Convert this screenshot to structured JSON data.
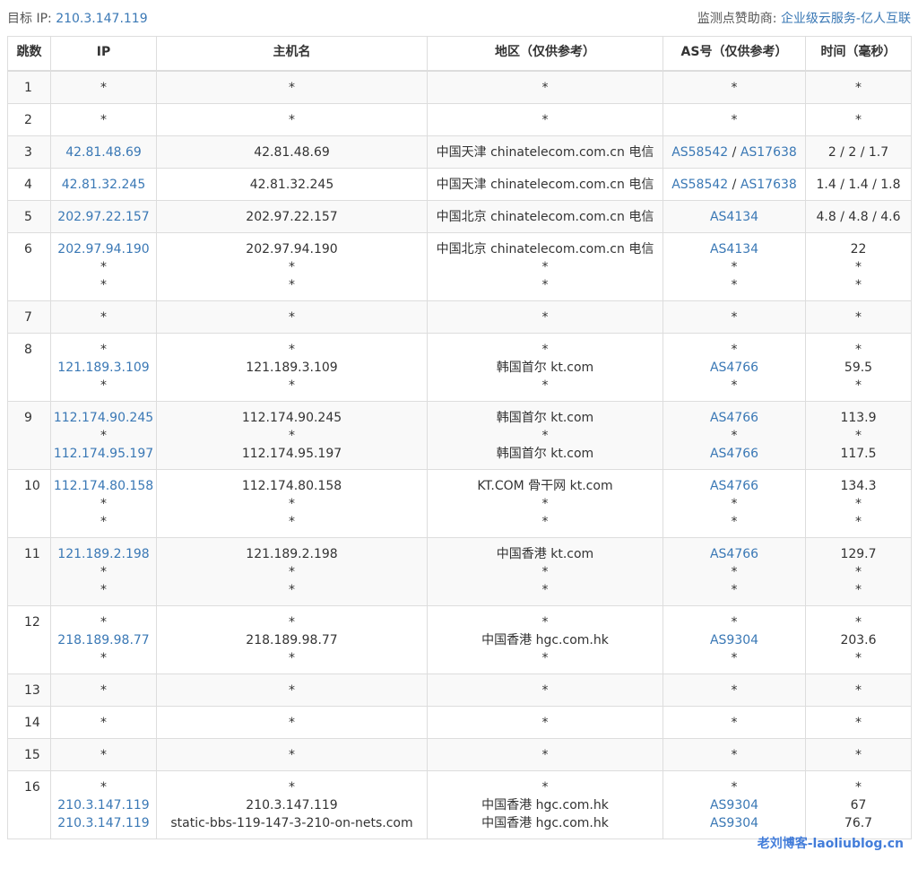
{
  "header": {
    "target_label": "目标 IP:",
    "target_ip": "210.3.147.119",
    "sponsor_label": "监测点赞助商:",
    "sponsor_name": "企业级云服务-亿人互联"
  },
  "table": {
    "columns": [
      "跳数",
      "IP",
      "主机名",
      "地区（仅供参考）",
      "AS号（仅供参考）",
      "时间（毫秒）"
    ],
    "rows": [
      {
        "hop": "1",
        "lines": [
          {
            "ip": "*",
            "host": "*",
            "region": "*",
            "as": [
              "*"
            ],
            "time": "*"
          }
        ]
      },
      {
        "hop": "2",
        "lines": [
          {
            "ip": "*",
            "host": "*",
            "region": "*",
            "as": [
              "*"
            ],
            "time": "*"
          }
        ]
      },
      {
        "hop": "3",
        "lines": [
          {
            "ip": "42.81.48.69",
            "host": "42.81.48.69",
            "region": "中国天津 chinatelecom.com.cn 电信",
            "as": [
              "AS58542",
              "AS17638"
            ],
            "time": "2 / 2 / 1.7"
          }
        ]
      },
      {
        "hop": "4",
        "lines": [
          {
            "ip": "42.81.32.245",
            "host": "42.81.32.245",
            "region": "中国天津 chinatelecom.com.cn 电信",
            "as": [
              "AS58542",
              "AS17638"
            ],
            "time": "1.4 / 1.4 / 1.8"
          }
        ]
      },
      {
        "hop": "5",
        "lines": [
          {
            "ip": "202.97.22.157",
            "host": "202.97.22.157",
            "region": "中国北京 chinatelecom.com.cn 电信",
            "as": [
              "AS4134"
            ],
            "time": "4.8 / 4.8 / 4.6"
          }
        ]
      },
      {
        "hop": "6",
        "lines": [
          {
            "ip": "202.97.94.190",
            "host": "202.97.94.190",
            "region": "中国北京 chinatelecom.com.cn 电信",
            "as": [
              "AS4134"
            ],
            "time": "22"
          },
          {
            "ip": "*",
            "host": "*",
            "region": "*",
            "as": [
              "*"
            ],
            "time": "*"
          },
          {
            "ip": "*",
            "host": "*",
            "region": "*",
            "as": [
              "*"
            ],
            "time": "*"
          }
        ]
      },
      {
        "hop": "7",
        "lines": [
          {
            "ip": "*",
            "host": "*",
            "region": "*",
            "as": [
              "*"
            ],
            "time": "*"
          }
        ]
      },
      {
        "hop": "8",
        "lines": [
          {
            "ip": "*",
            "host": "*",
            "region": "*",
            "as": [
              "*"
            ],
            "time": "*"
          },
          {
            "ip": "121.189.3.109",
            "host": "121.189.3.109",
            "region": "韩国首尔 kt.com",
            "as": [
              "AS4766"
            ],
            "time": "59.5"
          },
          {
            "ip": "*",
            "host": "*",
            "region": "*",
            "as": [
              "*"
            ],
            "time": "*"
          }
        ]
      },
      {
        "hop": "9",
        "lines": [
          {
            "ip": "112.174.90.245",
            "host": "112.174.90.245",
            "region": "韩国首尔 kt.com",
            "as": [
              "AS4766"
            ],
            "time": "113.9"
          },
          {
            "ip": "*",
            "host": "*",
            "region": "*",
            "as": [
              "*"
            ],
            "time": "*"
          },
          {
            "ip": "112.174.95.197",
            "host": "112.174.95.197",
            "region": "韩国首尔 kt.com",
            "as": [
              "AS4766"
            ],
            "time": "117.5"
          }
        ]
      },
      {
        "hop": "10",
        "lines": [
          {
            "ip": "112.174.80.158",
            "host": "112.174.80.158",
            "region": "KT.COM 骨干网 kt.com",
            "as": [
              "AS4766"
            ],
            "time": "134.3"
          },
          {
            "ip": "*",
            "host": "*",
            "region": "*",
            "as": [
              "*"
            ],
            "time": "*"
          },
          {
            "ip": "*",
            "host": "*",
            "region": "*",
            "as": [
              "*"
            ],
            "time": "*"
          }
        ]
      },
      {
        "hop": "11",
        "lines": [
          {
            "ip": "121.189.2.198",
            "host": "121.189.2.198",
            "region": "中国香港 kt.com",
            "as": [
              "AS4766"
            ],
            "time": "129.7"
          },
          {
            "ip": "*",
            "host": "*",
            "region": "*",
            "as": [
              "*"
            ],
            "time": "*"
          },
          {
            "ip": "*",
            "host": "*",
            "region": "*",
            "as": [
              "*"
            ],
            "time": "*"
          }
        ]
      },
      {
        "hop": "12",
        "lines": [
          {
            "ip": "*",
            "host": "*",
            "region": "*",
            "as": [
              "*"
            ],
            "time": "*"
          },
          {
            "ip": "218.189.98.77",
            "host": "218.189.98.77",
            "region": "中国香港 hgc.com.hk",
            "as": [
              "AS9304"
            ],
            "time": "203.6"
          },
          {
            "ip": "*",
            "host": "*",
            "region": "*",
            "as": [
              "*"
            ],
            "time": "*"
          }
        ]
      },
      {
        "hop": "13",
        "lines": [
          {
            "ip": "*",
            "host": "*",
            "region": "*",
            "as": [
              "*"
            ],
            "time": "*"
          }
        ]
      },
      {
        "hop": "14",
        "lines": [
          {
            "ip": "*",
            "host": "*",
            "region": "*",
            "as": [
              "*"
            ],
            "time": "*"
          }
        ]
      },
      {
        "hop": "15",
        "lines": [
          {
            "ip": "*",
            "host": "*",
            "region": "*",
            "as": [
              "*"
            ],
            "time": "*"
          }
        ]
      },
      {
        "hop": "16",
        "lines": [
          {
            "ip": "*",
            "host": "*",
            "region": "*",
            "as": [
              "*"
            ],
            "time": "*"
          },
          {
            "ip": "210.3.147.119",
            "host": "210.3.147.119",
            "region": "中国香港 hgc.com.hk",
            "as": [
              "AS9304"
            ],
            "time": "67"
          },
          {
            "ip": "210.3.147.119",
            "host": "static-bbs-119-147-3-210-on-nets.com",
            "region": "中国香港 hgc.com.hk",
            "as": [
              "AS9304"
            ],
            "time": "76.7"
          }
        ]
      }
    ]
  },
  "watermark": "老刘博客-laoliublog.cn",
  "colors": {
    "link": "#3a78b5",
    "border": "#dddddd",
    "stripe": "#f9f9f9",
    "watermark": "#2f6fd6"
  }
}
